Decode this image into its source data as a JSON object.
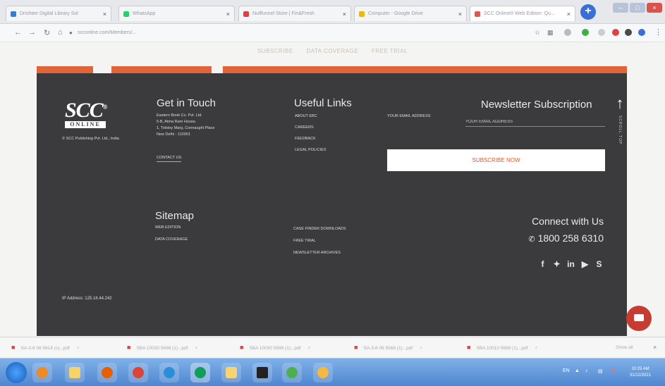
{
  "browser": {
    "tabs": [
      {
        "title": "Drishtee Digital Library Sol",
        "favicon_color": "#3a7bd5"
      },
      {
        "title": "WhatsApp",
        "favicon_color": "#25d366"
      },
      {
        "title": "Nullfunnel Store | Fin&Fresh",
        "favicon_color": "#e04040"
      },
      {
        "title": "Computer - Google Drive",
        "favicon_color": "#f4b400"
      },
      {
        "title": "SCC Online® Web Edition: Qu...",
        "favicon_color": "#e2564e"
      }
    ],
    "tab_close_glyph": "×",
    "new_tab_glyph": "+",
    "address": "scconline.com/Members/...",
    "window_controls": [
      "–",
      "□",
      "×"
    ]
  },
  "page": {
    "top_links": [
      "SUBSCRIBE",
      "DATA COVERAGE",
      "FREE TRIAL"
    ],
    "logo": {
      "main": "SCC",
      "mark": "®",
      "sub": "ONLINE"
    },
    "copyright": "© SCC Publishing Pvt. Ltd., India",
    "get_in_touch": {
      "title": "Get in Touch",
      "address_lines": [
        "Eastern Book Co. Pvt. Ltd.",
        "5-B, Atma Ram House,",
        "1, Tolstoy Marg, Connaught Place",
        "New Delhi - 110001"
      ],
      "contact_link": "CONTACT US"
    },
    "useful_links": {
      "title": "Useful Links",
      "items": [
        "ABOUT EBC",
        "CAREERS",
        "FEEDBACK",
        "LEGAL POLICIES"
      ]
    },
    "newsletter": {
      "title": "Newsletter Subscription",
      "email_placeholder": "YOUR EMAIL ADDRESS",
      "button": "SUBSCRIBE NOW"
    },
    "scroll_top_label": "SCROLL TOP",
    "sitemap": {
      "title": "Sitemap",
      "col1": [
        "WEB EDITION",
        "DATA COVERAGE"
      ],
      "col2": [
        "CASE FINDER DOWNLOADS",
        "FREE TRIAL",
        "NEWSLETTER ARCHIVES"
      ]
    },
    "connect": {
      "title": "Connect with Us",
      "phone": "1800 258 6310",
      "socials": [
        "facebook",
        "twitter",
        "linkedin",
        "youtube",
        "skype"
      ]
    },
    "ip_address": "IP Address: 125.18.44.242"
  },
  "downloads": {
    "items": [
      "SA-3-8 06 5618 (c)...pdf",
      "SBA 10030 5698 (1)...pdf",
      "SBA 10030 5698 (1)...pdf",
      "SA-3-8 06 5568 (1)...pdf",
      "SBA 10010 5698 (1)...pdf"
    ],
    "show_all": "Show all"
  },
  "taskbar": {
    "lang": "EN",
    "time": "10:25 AM",
    "date": "31/12/2021"
  },
  "colors": {
    "footer_bg": "#3b3b3d",
    "accent_orange": "#e0633a",
    "chat_red": "#c73c32"
  }
}
